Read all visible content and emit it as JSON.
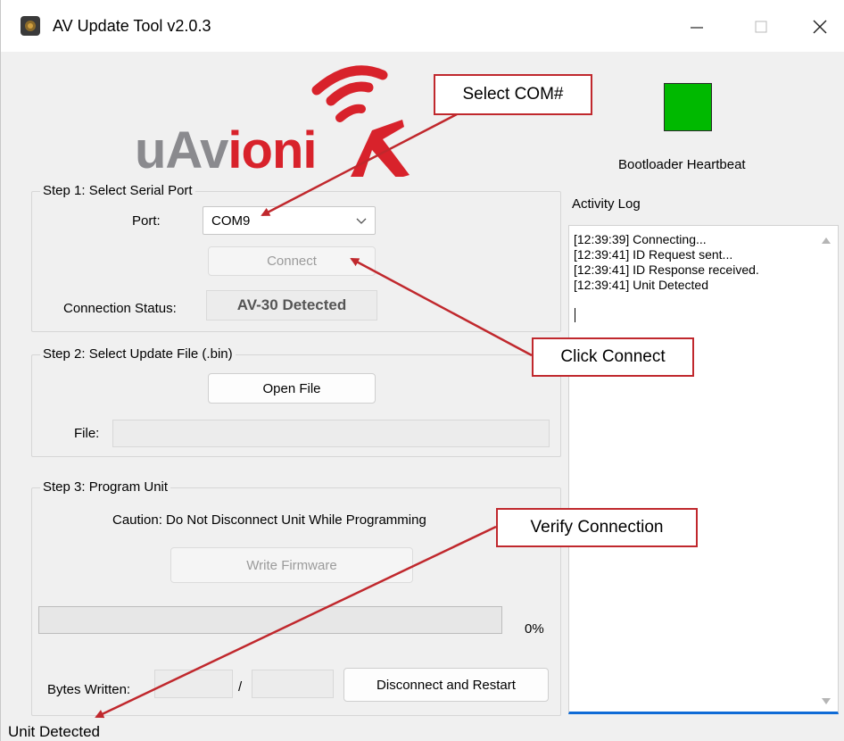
{
  "window": {
    "title": "AV Update Tool v2.0.3",
    "controls": {
      "minimize": "minimize-icon",
      "maximize": "maximize-icon",
      "close": "close-icon"
    }
  },
  "logo": {
    "part1": "uAv",
    "part2": "ioni"
  },
  "step1": {
    "legend": "Step 1: Select Serial Port",
    "port_label": "Port:",
    "port_value": "COM9",
    "connect_label": "Connect",
    "status_label": "Connection Status:",
    "status_value": "AV-30 Detected"
  },
  "step2": {
    "legend": "Step 2: Select Update File (.bin)",
    "open_label": "Open File",
    "file_label": "File:",
    "file_value": ""
  },
  "step3": {
    "legend": "Step 3: Program Unit",
    "caution": "Caution: Do Not Disconnect Unit While Programming",
    "write_label": "Write Firmware",
    "progress_text": "0%",
    "progress_value": 0,
    "bytes_label": "Bytes Written:",
    "bytes_written": "",
    "separator": "/",
    "bytes_total": "",
    "disconnect_label": "Disconnect and Restart"
  },
  "heartbeat": {
    "label": "Bootloader Heartbeat",
    "color": "#00b900"
  },
  "log": {
    "label": "Activity Log",
    "lines": [
      "[12:39:39] Connecting...",
      "[12:39:41] ID Request sent...",
      "[12:39:41] ID Response received.",
      "[12:39:41] Unit Detected"
    ]
  },
  "statusbar": {
    "text": "Unit Detected"
  },
  "annotations": {
    "select_com": "Select COM#",
    "click_connect": "Click Connect",
    "verify_connection": "Verify Connection",
    "color": "#c0282d"
  }
}
